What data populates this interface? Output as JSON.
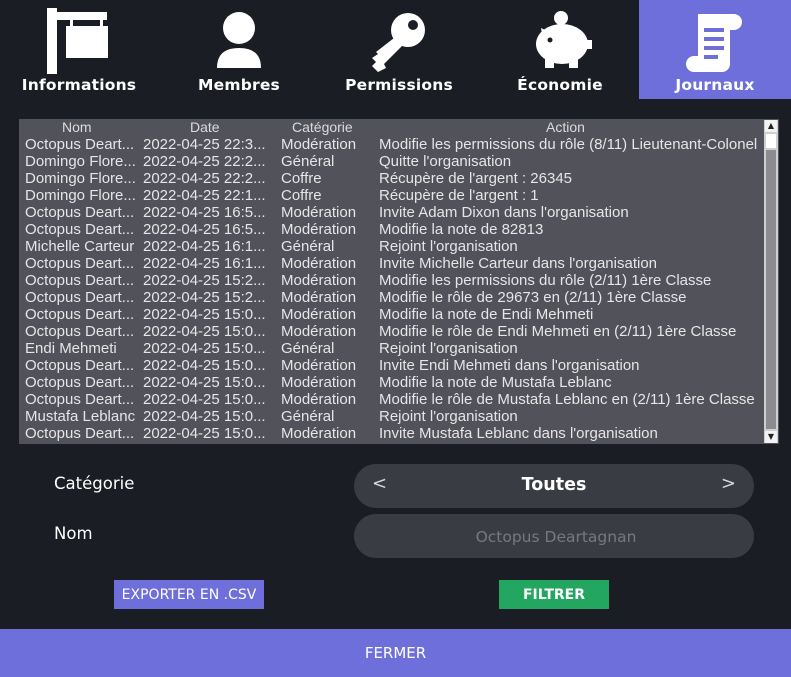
{
  "tabs": [
    {
      "label": "Informations",
      "icon": "sign-icon"
    },
    {
      "label": "Membres",
      "icon": "user-icon"
    },
    {
      "label": "Permissions",
      "icon": "key-icon"
    },
    {
      "label": "Économie",
      "icon": "piggy-bank-icon"
    },
    {
      "label": "Journaux",
      "icon": "scroll-icon",
      "active": true
    }
  ],
  "log": {
    "headers": {
      "nom": "Nom",
      "date": "Date",
      "categorie": "Catégorie",
      "action": "Action"
    },
    "rows": [
      {
        "nom": "Octopus Deart...",
        "date": "2022-04-25 22:3...",
        "categorie": "Modération",
        "action": "Modifie les permissions du rôle (8/11) Lieutenant-Colonel"
      },
      {
        "nom": "Domingo Flore...",
        "date": "2022-04-25 22:2...",
        "categorie": "Général",
        "action": "Quitte l'organisation"
      },
      {
        "nom": "Domingo Flore...",
        "date": "2022-04-25 22:2...",
        "categorie": "Coffre",
        "action": "Récupère de l'argent : 26345"
      },
      {
        "nom": "Domingo Flore...",
        "date": "2022-04-25 22:1...",
        "categorie": "Coffre",
        "action": "Récupère de l'argent : 1"
      },
      {
        "nom": "Octopus Deart...",
        "date": "2022-04-25 16:5...",
        "categorie": "Modération",
        "action": "Invite Adam Dixon dans l'organisation"
      },
      {
        "nom": "Octopus Deart...",
        "date": "2022-04-25 16:5...",
        "categorie": "Modération",
        "action": "Modifie la note de 82813"
      },
      {
        "nom": "Michelle Carteur",
        "date": "2022-04-25 16:1...",
        "categorie": "Général",
        "action": "Rejoint l'organisation"
      },
      {
        "nom": "Octopus Deart...",
        "date": "2022-04-25 16:1...",
        "categorie": "Modération",
        "action": "Invite Michelle Carteur dans l'organisation"
      },
      {
        "nom": "Octopus Deart...",
        "date": "2022-04-25 15:2...",
        "categorie": "Modération",
        "action": "Modifie les permissions du rôle (2/11) 1ère Classe"
      },
      {
        "nom": "Octopus Deart...",
        "date": "2022-04-25 15:2...",
        "categorie": "Modération",
        "action": "Modifie le rôle de 29673 en (2/11) 1ère Classe"
      },
      {
        "nom": "Octopus Deart...",
        "date": "2022-04-25 15:0...",
        "categorie": "Modération",
        "action": "Modifie la note de Endi Mehmeti"
      },
      {
        "nom": "Octopus Deart...",
        "date": "2022-04-25 15:0...",
        "categorie": "Modération",
        "action": "Modifie le rôle de Endi Mehmeti en (2/11) 1ère Classe"
      },
      {
        "nom": "Endi Mehmeti",
        "date": "2022-04-25 15:0...",
        "categorie": "Général",
        "action": "Rejoint l'organisation"
      },
      {
        "nom": "Octopus Deart...",
        "date": "2022-04-25 15:0...",
        "categorie": "Modération",
        "action": "Invite Endi Mehmeti dans l'organisation"
      },
      {
        "nom": "Octopus Deart...",
        "date": "2022-04-25 15:0...",
        "categorie": "Modération",
        "action": "Modifie la note de Mustafa Leblanc"
      },
      {
        "nom": "Octopus Deart...",
        "date": "2022-04-25 15:0...",
        "categorie": "Modération",
        "action": "Modifie le rôle de Mustafa Leblanc en (2/11) 1ère Classe"
      },
      {
        "nom": "Mustafa Leblanc",
        "date": "2022-04-25 15:0...",
        "categorie": "Général",
        "action": "Rejoint l'organisation"
      },
      {
        "nom": "Octopus Deart...",
        "date": "2022-04-25 15:0...",
        "categorie": "Modération",
        "action": "Invite Mustafa Leblanc dans l'organisation"
      }
    ]
  },
  "filters": {
    "categorie_label": "Catégorie",
    "categorie_prev": "<",
    "categorie_value": "Toutes",
    "categorie_next": ">",
    "nom_label": "Nom",
    "nom_placeholder": "Octopus Deartagnan"
  },
  "buttons": {
    "export": "EXPORTER EN .CSV",
    "filter": "FILTRER",
    "close": "FERMER"
  },
  "colors": {
    "accent": "#6f6fdc",
    "filter": "#22a660",
    "background": "#1b1d24",
    "panel": "#51525a"
  }
}
